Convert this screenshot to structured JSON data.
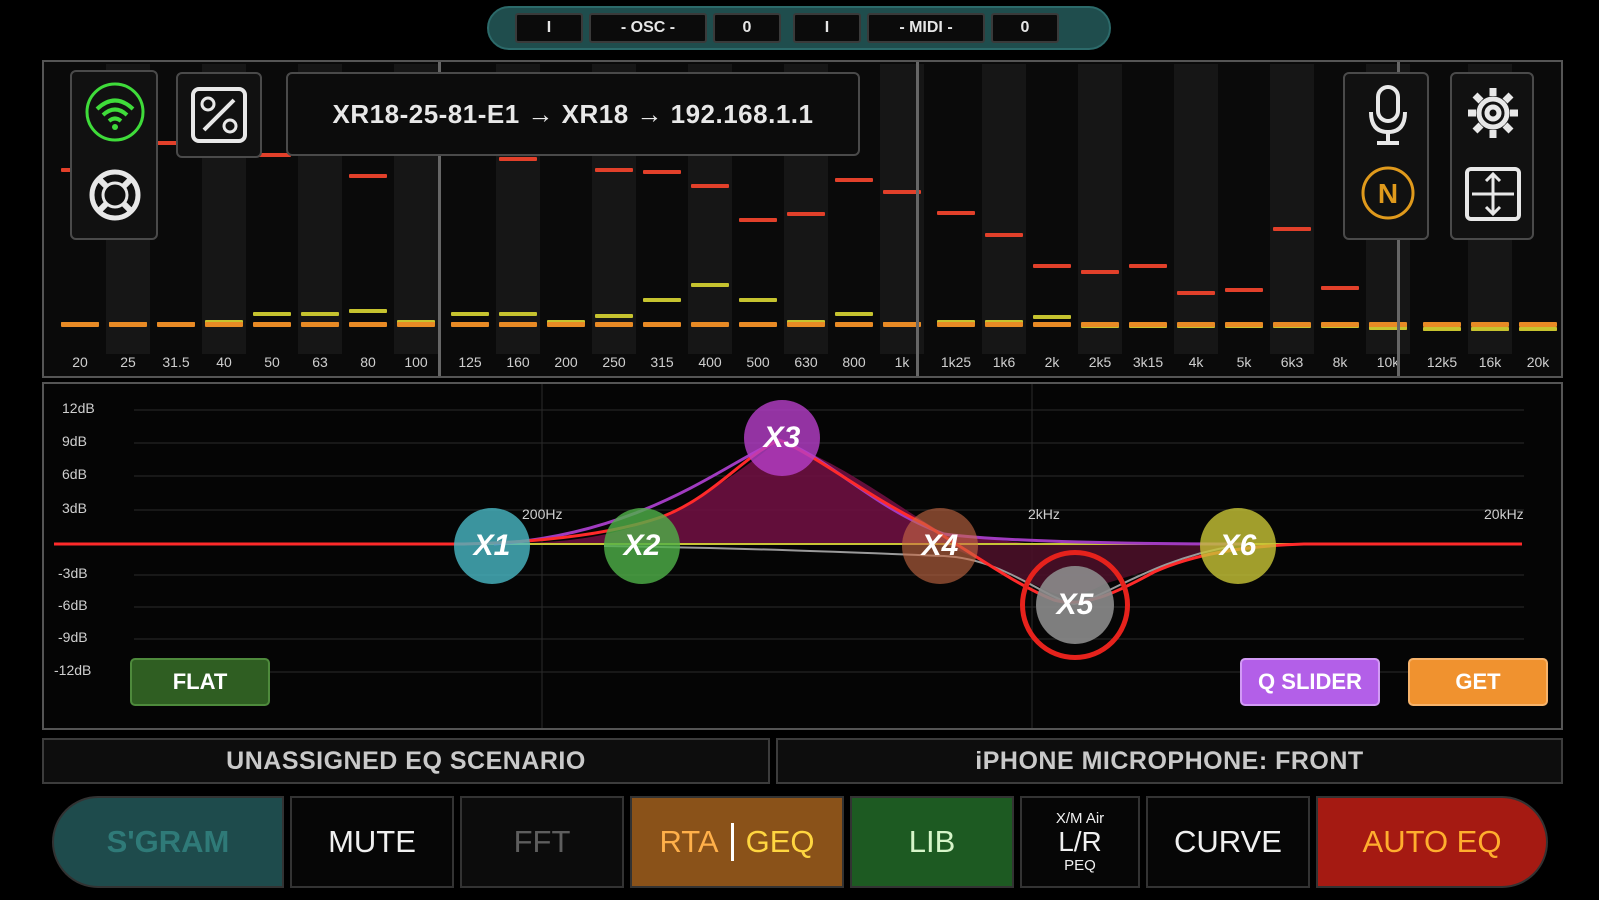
{
  "top_bar": {
    "segments": [
      "I",
      "- OSC -",
      "0",
      "I",
      "- MIDI -",
      "0"
    ]
  },
  "connection": {
    "route": "XR18-25-81-E1 → XR18 → 192.168.1.1"
  },
  "rta": {
    "bands": [
      {
        "label": "20",
        "peak": 166,
        "level": 320
      },
      {
        "label": "25",
        "peak": 172,
        "level": 320
      },
      {
        "label": "31.5",
        "peak": 139,
        "level": 320
      },
      {
        "label": "40",
        "peak": 135,
        "level": 318
      },
      {
        "label": "50",
        "peak": 151,
        "level": 310
      },
      {
        "label": "63",
        "peak": 320,
        "level": 310
      },
      {
        "label": "80",
        "peak": 172,
        "level": 307
      },
      {
        "label": "100",
        "peak": 320,
        "level": 318
      },
      {
        "label": "125",
        "peak": 320,
        "level": 310
      },
      {
        "label": "160",
        "peak": 155,
        "level": 310
      },
      {
        "label": "200",
        "peak": 320,
        "level": 318
      },
      {
        "label": "250",
        "peak": 166,
        "level": 312
      },
      {
        "label": "315",
        "peak": 168,
        "level": 296
      },
      {
        "label": "400",
        "peak": 182,
        "level": 281
      },
      {
        "label": "500",
        "peak": 216,
        "level": 296
      },
      {
        "label": "630",
        "peak": 210,
        "level": 318
      },
      {
        "label": "800",
        "peak": 176,
        "level": 310
      },
      {
        "label": "1k",
        "peak": 188,
        "level": 320
      },
      {
        "label": "1k25",
        "peak": 209,
        "level": 318
      },
      {
        "label": "1k6",
        "peak": 231,
        "level": 318
      },
      {
        "label": "2k",
        "peak": 262,
        "level": 313
      },
      {
        "label": "2k5",
        "peak": 268,
        "level": 322
      },
      {
        "label": "3k15",
        "peak": 262,
        "level": 322
      },
      {
        "label": "4k",
        "peak": 289,
        "level": 322
      },
      {
        "label": "5k",
        "peak": 286,
        "level": 322
      },
      {
        "label": "6k3",
        "peak": 225,
        "level": 322
      },
      {
        "label": "8k",
        "peak": 284,
        "level": 322
      },
      {
        "label": "10k",
        "peak": 324,
        "level": 324
      },
      {
        "label": "12k5",
        "peak": 325,
        "level": 325
      },
      {
        "label": "16k",
        "peak": 325,
        "level": 325
      },
      {
        "label": "20k",
        "peak": 325,
        "level": 325
      }
    ]
  },
  "eq": {
    "db_labels": [
      "12dB",
      "9dB",
      "6dB",
      "3dB",
      "-3dB",
      "-6dB",
      "-9dB",
      "-12dB"
    ],
    "hz_labels": [
      "200Hz",
      "2kHz",
      "20kHz"
    ],
    "nodes": [
      {
        "label": "X1",
        "color": "#49b8c4"
      },
      {
        "label": "X2",
        "color": "#4fb248"
      },
      {
        "label": "X3",
        "color": "#b63ec9"
      },
      {
        "label": "X4",
        "color": "#c96a45"
      },
      {
        "label": "X5",
        "color": "#8c8c8c"
      },
      {
        "label": "X6",
        "color": "#c8c436"
      }
    ],
    "flat_label": "FLAT",
    "q_slider_label": "Q SLIDER",
    "get_label": "GET"
  },
  "scenario": {
    "left": "UNASSIGNED EQ SCENARIO",
    "right": "iPHONE MICROPHONE: FRONT"
  },
  "toolbar": {
    "sgram": "S'GRAM",
    "mute": "MUTE",
    "fft": "FFT",
    "rta": "RTA",
    "geq": "GEQ",
    "lib": "LIB",
    "lr_top": "X/M Air",
    "lr_mid": "L/R",
    "lr_bot": "PEQ",
    "curve": "CURVE",
    "auto_eq": "AUTO EQ"
  },
  "colors": {
    "peak": "#e2402a",
    "level_orange": "#e88a25",
    "level_yellow": "#c6c32f",
    "wifi": "#3fdc3a",
    "noise_ring": "#e09a1c",
    "flat_bg": "#2f5e22",
    "q_slider_bg": "#b35fe8",
    "get_bg": "#f0922f"
  }
}
